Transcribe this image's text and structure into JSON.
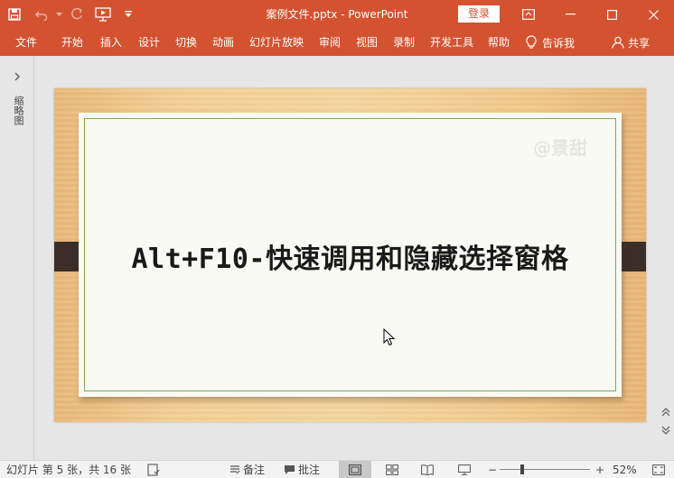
{
  "titlebar": {
    "document_title": "案例文件.pptx  -  PowerPoint",
    "login_label": "登录",
    "qat_icons": [
      "save-icon",
      "undo-icon",
      "redo-icon",
      "present-from-start-icon",
      "customize-qat-icon"
    ],
    "window_icons": [
      "ribbon-display-options-icon",
      "minimize-icon",
      "maximize-icon",
      "close-icon"
    ],
    "accent_color": "#d35230"
  },
  "ribbon": {
    "tabs": [
      "文件",
      "开始",
      "插入",
      "设计",
      "切换",
      "动画",
      "幻灯片放映",
      "审阅",
      "视图",
      "录制",
      "开发工具",
      "帮助"
    ],
    "tell_me_label": "告诉我",
    "share_label": "共享"
  },
  "leftpane": {
    "vertical_label": "缩略图"
  },
  "slide": {
    "title": "Alt+F10-快速调用和隐藏选择窗格",
    "watermark": "@景甜"
  },
  "statusbar": {
    "slide_info": "幻灯片 第 5 张，共 16 张",
    "notes_label": "备注",
    "comments_label": "批注",
    "zoom_minus": "−",
    "zoom_plus": "+",
    "zoom_level": "52%"
  }
}
